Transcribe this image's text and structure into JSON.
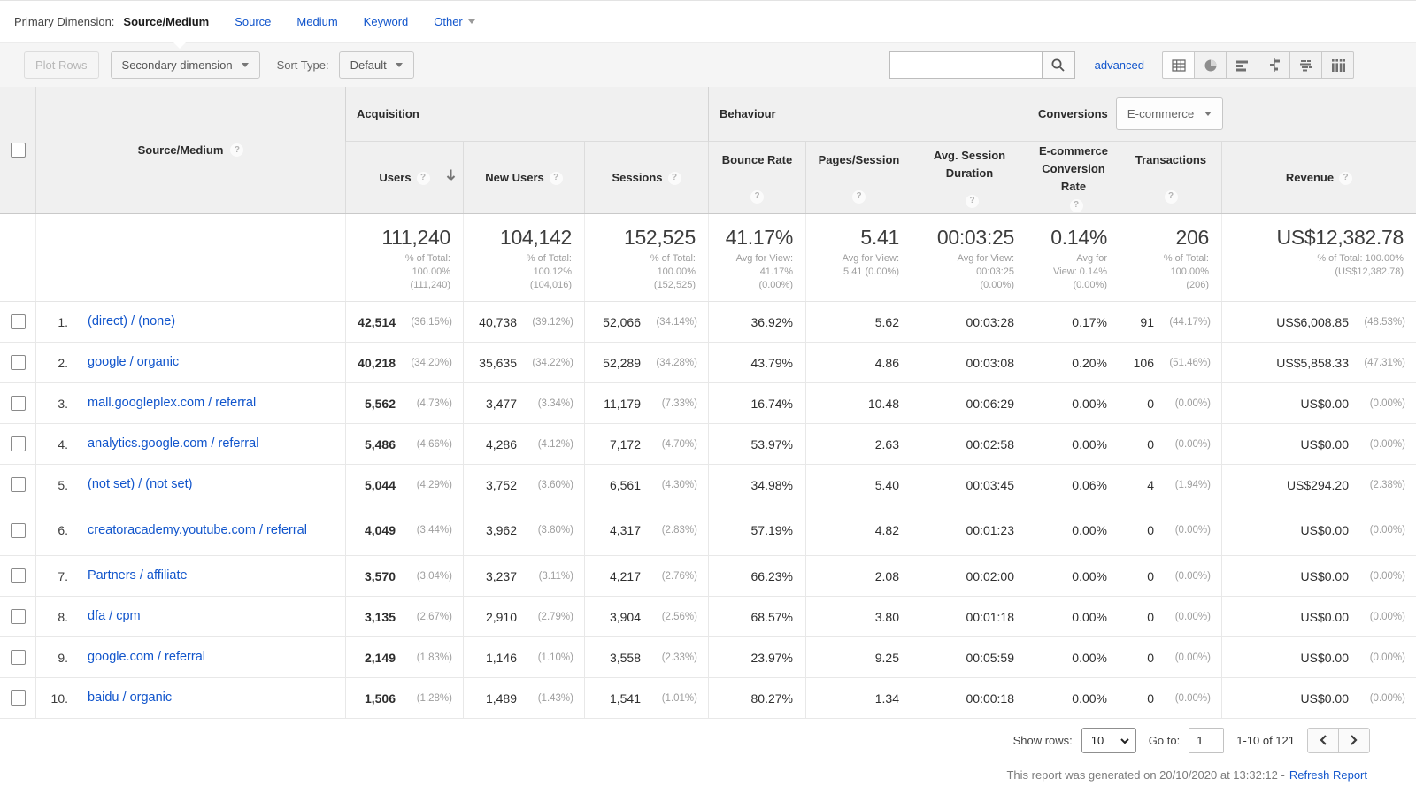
{
  "colors": {
    "link": "#1155cc",
    "header_bg": "#f0f0f0",
    "toolbar_bg": "#f5f5f5",
    "text": "#333333",
    "muted": "#9e9e9e"
  },
  "primary_dimension": {
    "label": "Primary Dimension:",
    "selected": "Source/Medium",
    "links": [
      "Source",
      "Medium",
      "Keyword"
    ],
    "other_label": "Other"
  },
  "toolbar": {
    "plot_rows": "Plot Rows",
    "secondary_dimension": "Secondary dimension",
    "sort_type_label": "Sort Type:",
    "sort_type_value": "Default",
    "advanced_label": "advanced"
  },
  "table": {
    "sections": {
      "acquisition": "Acquisition",
      "behaviour": "Behaviour",
      "conversions": "Conversions",
      "conversions_selector": "E-commerce"
    },
    "dimension_header": "Source/Medium",
    "columns": [
      "Users",
      "New Users",
      "Sessions",
      "Bounce Rate",
      "Pages/Session",
      "Avg. Session Duration",
      "E-commerce Conversion Rate",
      "Transactions",
      "Revenue"
    ],
    "totals": [
      {
        "big": "111,240",
        "sub": "% of Total:\n100.00%\n(111,240)"
      },
      {
        "big": "104,142",
        "sub": "% of Total:\n100.12%\n(104,016)"
      },
      {
        "big": "152,525",
        "sub": "% of Total:\n100.00%\n(152,525)"
      },
      {
        "big": "41.17%",
        "sub": "Avg for View:\n41.17%\n(0.00%)"
      },
      {
        "big": "5.41",
        "sub": "Avg for View:\n5.41 (0.00%)"
      },
      {
        "big": "00:03:25",
        "sub": "Avg for View:\n00:03:25\n(0.00%)"
      },
      {
        "big": "0.14%",
        "sub": "Avg for\nView: 0.14%\n(0.00%)"
      },
      {
        "big": "206",
        "sub": "% of Total:\n100.00%\n(206)"
      },
      {
        "big": "US$12,382.78",
        "sub": "% of Total: 100.00%\n(US$12,382.78)"
      }
    ],
    "rows": [
      {
        "index": "1.",
        "source": "(direct) / (none)",
        "users": [
          "42,514",
          "(36.15%)"
        ],
        "new_users": [
          "40,738",
          "(39.12%)"
        ],
        "sessions": [
          "52,066",
          "(34.14%)"
        ],
        "bounce_rate": "36.92%",
        "pages_session": "5.62",
        "avg_duration": "00:03:28",
        "conv_rate": "0.17%",
        "transactions": [
          "91",
          "(44.17%)"
        ],
        "revenue": [
          "US$6,008.85",
          "(48.53%)"
        ]
      },
      {
        "index": "2.",
        "source": "google / organic",
        "users": [
          "40,218",
          "(34.20%)"
        ],
        "new_users": [
          "35,635",
          "(34.22%)"
        ],
        "sessions": [
          "52,289",
          "(34.28%)"
        ],
        "bounce_rate": "43.79%",
        "pages_session": "4.86",
        "avg_duration": "00:03:08",
        "conv_rate": "0.20%",
        "transactions": [
          "106",
          "(51.46%)"
        ],
        "revenue": [
          "US$5,858.33",
          "(47.31%)"
        ]
      },
      {
        "index": "3.",
        "source": "mall.googleplex.com / referral",
        "users": [
          "5,562",
          "(4.73%)"
        ],
        "new_users": [
          "3,477",
          "(3.34%)"
        ],
        "sessions": [
          "11,179",
          "(7.33%)"
        ],
        "bounce_rate": "16.74%",
        "pages_session": "10.48",
        "avg_duration": "00:06:29",
        "conv_rate": "0.00%",
        "transactions": [
          "0",
          "(0.00%)"
        ],
        "revenue": [
          "US$0.00",
          "(0.00%)"
        ]
      },
      {
        "index": "4.",
        "source": "analytics.google.com / referral",
        "users": [
          "5,486",
          "(4.66%)"
        ],
        "new_users": [
          "4,286",
          "(4.12%)"
        ],
        "sessions": [
          "7,172",
          "(4.70%)"
        ],
        "bounce_rate": "53.97%",
        "pages_session": "2.63",
        "avg_duration": "00:02:58",
        "conv_rate": "0.00%",
        "transactions": [
          "0",
          "(0.00%)"
        ],
        "revenue": [
          "US$0.00",
          "(0.00%)"
        ]
      },
      {
        "index": "5.",
        "source": "(not set) / (not set)",
        "users": [
          "5,044",
          "(4.29%)"
        ],
        "new_users": [
          "3,752",
          "(3.60%)"
        ],
        "sessions": [
          "6,561",
          "(4.30%)"
        ],
        "bounce_rate": "34.98%",
        "pages_session": "5.40",
        "avg_duration": "00:03:45",
        "conv_rate": "0.06%",
        "transactions": [
          "4",
          "(1.94%)"
        ],
        "revenue": [
          "US$294.20",
          "(2.38%)"
        ]
      },
      {
        "index": "6.",
        "source": "creatoracademy.youtube.com / referral",
        "users": [
          "4,049",
          "(3.44%)"
        ],
        "new_users": [
          "3,962",
          "(3.80%)"
        ],
        "sessions": [
          "4,317",
          "(2.83%)"
        ],
        "bounce_rate": "57.19%",
        "pages_session": "4.82",
        "avg_duration": "00:01:23",
        "conv_rate": "0.00%",
        "transactions": [
          "0",
          "(0.00%)"
        ],
        "revenue": [
          "US$0.00",
          "(0.00%)"
        ]
      },
      {
        "index": "7.",
        "source": "Partners / affiliate",
        "users": [
          "3,570",
          "(3.04%)"
        ],
        "new_users": [
          "3,237",
          "(3.11%)"
        ],
        "sessions": [
          "4,217",
          "(2.76%)"
        ],
        "bounce_rate": "66.23%",
        "pages_session": "2.08",
        "avg_duration": "00:02:00",
        "conv_rate": "0.00%",
        "transactions": [
          "0",
          "(0.00%)"
        ],
        "revenue": [
          "US$0.00",
          "(0.00%)"
        ]
      },
      {
        "index": "8.",
        "source": "dfa / cpm",
        "users": [
          "3,135",
          "(2.67%)"
        ],
        "new_users": [
          "2,910",
          "(2.79%)"
        ],
        "sessions": [
          "3,904",
          "(2.56%)"
        ],
        "bounce_rate": "68.57%",
        "pages_session": "3.80",
        "avg_duration": "00:01:18",
        "conv_rate": "0.00%",
        "transactions": [
          "0",
          "(0.00%)"
        ],
        "revenue": [
          "US$0.00",
          "(0.00%)"
        ]
      },
      {
        "index": "9.",
        "source": "google.com / referral",
        "users": [
          "2,149",
          "(1.83%)"
        ],
        "new_users": [
          "1,146",
          "(1.10%)"
        ],
        "sessions": [
          "3,558",
          "(2.33%)"
        ],
        "bounce_rate": "23.97%",
        "pages_session": "9.25",
        "avg_duration": "00:05:59",
        "conv_rate": "0.00%",
        "transactions": [
          "0",
          "(0.00%)"
        ],
        "revenue": [
          "US$0.00",
          "(0.00%)"
        ]
      },
      {
        "index": "10.",
        "source": "baidu / organic",
        "users": [
          "1,506",
          "(1.28%)"
        ],
        "new_users": [
          "1,489",
          "(1.43%)"
        ],
        "sessions": [
          "1,541",
          "(1.01%)"
        ],
        "bounce_rate": "80.27%",
        "pages_session": "1.34",
        "avg_duration": "00:00:18",
        "conv_rate": "0.00%",
        "transactions": [
          "0",
          "(0.00%)"
        ],
        "revenue": [
          "US$0.00",
          "(0.00%)"
        ]
      }
    ]
  },
  "footer": {
    "show_rows_label": "Show rows:",
    "show_rows_value": "10",
    "goto_label": "Go to:",
    "goto_value": "1",
    "range": "1-10 of 121",
    "generated_text": "This report was generated on 20/10/2020 at 13:32:12 -",
    "refresh_label": "Refresh Report"
  }
}
